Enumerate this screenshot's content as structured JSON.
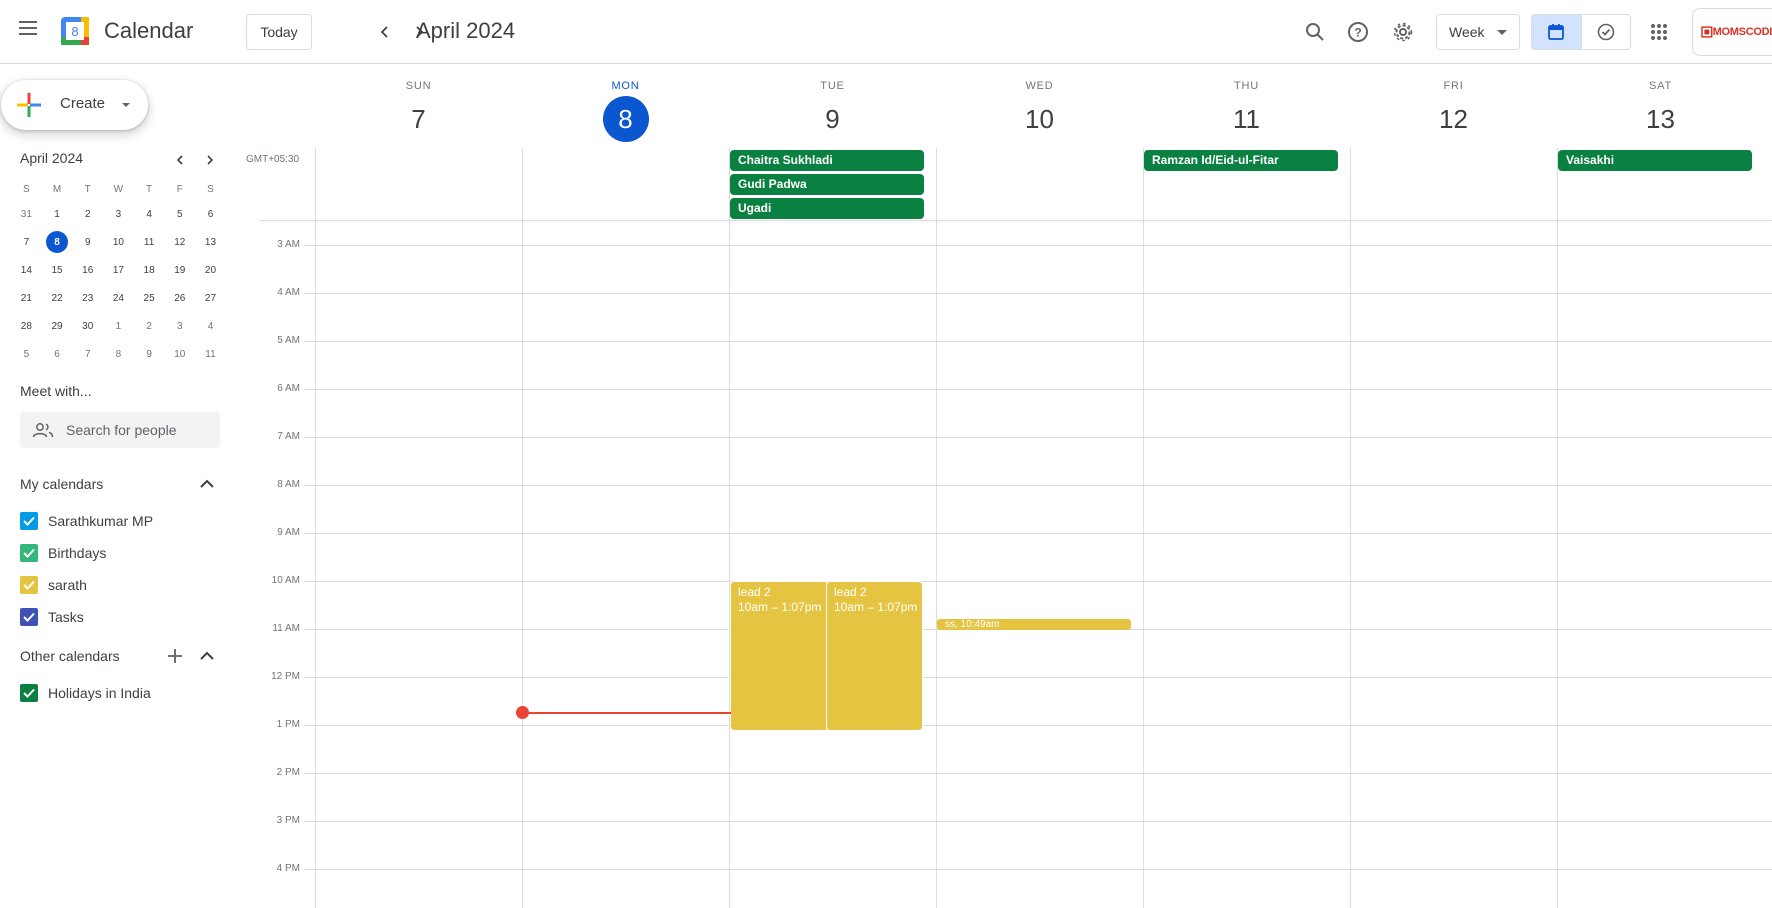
{
  "app": {
    "title": "Calendar",
    "logo_day": "8"
  },
  "toolbar": {
    "today_label": "Today",
    "month_title": "April 2024",
    "view_label": "Week",
    "account_text": "MOMSCODI"
  },
  "sidebar": {
    "create_label": "Create",
    "mini_calendar": {
      "title": "April 2024",
      "weekday_headers": [
        "S",
        "M",
        "T",
        "W",
        "T",
        "F",
        "S"
      ],
      "weeks": [
        [
          "31",
          "1",
          "2",
          "3",
          "4",
          "5",
          "6"
        ],
        [
          "7",
          "8",
          "9",
          "10",
          "11",
          "12",
          "13"
        ],
        [
          "14",
          "15",
          "16",
          "17",
          "18",
          "19",
          "20"
        ],
        [
          "21",
          "22",
          "23",
          "24",
          "25",
          "26",
          "27"
        ],
        [
          "28",
          "29",
          "30",
          "1",
          "2",
          "3",
          "4"
        ],
        [
          "5",
          "6",
          "7",
          "8",
          "9",
          "10",
          "11"
        ]
      ],
      "today": "8"
    },
    "meet_title": "Meet with...",
    "people_search_placeholder": "Search for people",
    "my_calendars_title": "My calendars",
    "my_calendars": [
      {
        "label": "Sarathkumar MP",
        "color": "#039be5"
      },
      {
        "label": "Birthdays",
        "color": "#33b679"
      },
      {
        "label": "sarath",
        "color": "#e4c441"
      },
      {
        "label": "Tasks",
        "color": "#3f51b5"
      }
    ],
    "other_calendars_title": "Other calendars",
    "other_calendars": [
      {
        "label": "Holidays in India",
        "color": "#0b8043"
      }
    ]
  },
  "week": {
    "timezone": "GMT+05:30",
    "days": [
      {
        "name": "SUN",
        "num": "7"
      },
      {
        "name": "MON",
        "num": "8"
      },
      {
        "name": "TUE",
        "num": "9"
      },
      {
        "name": "WED",
        "num": "10"
      },
      {
        "name": "THU",
        "num": "11"
      },
      {
        "name": "FRI",
        "num": "12"
      },
      {
        "name": "SAT",
        "num": "13"
      }
    ],
    "today_index": 1,
    "hours": [
      "3 AM",
      "4 AM",
      "5 AM",
      "6 AM",
      "7 AM",
      "8 AM",
      "9 AM",
      "10 AM",
      "11 AM",
      "12 PM",
      "1 PM",
      "2 PM",
      "3 PM",
      "4 PM"
    ],
    "allday_events": [
      {
        "title": "Chaitra Sukhladi",
        "day": "TUE"
      },
      {
        "title": "Gudi Padwa",
        "day": "TUE"
      },
      {
        "title": "Ugadi",
        "day": "TUE"
      },
      {
        "title": "Ramzan Id/Eid-ul-Fitar",
        "day": "THU"
      },
      {
        "title": "Vaisakhi",
        "day": "SAT"
      }
    ],
    "timed_events": [
      {
        "title": "lead 2",
        "time": "10am – 1:07pm",
        "day": "TUE"
      },
      {
        "title": "lead 2",
        "time": "10am – 1:07pm",
        "day": "TUE"
      }
    ],
    "chip_event": {
      "title": "ss",
      "time": "10:49am",
      "label": "ss, 10:49am",
      "day": "WED"
    },
    "colors": {
      "holiday": "#0b8043",
      "sarath": "#e4c441",
      "now": "#ea4335",
      "accent": "#0b57d0"
    }
  }
}
